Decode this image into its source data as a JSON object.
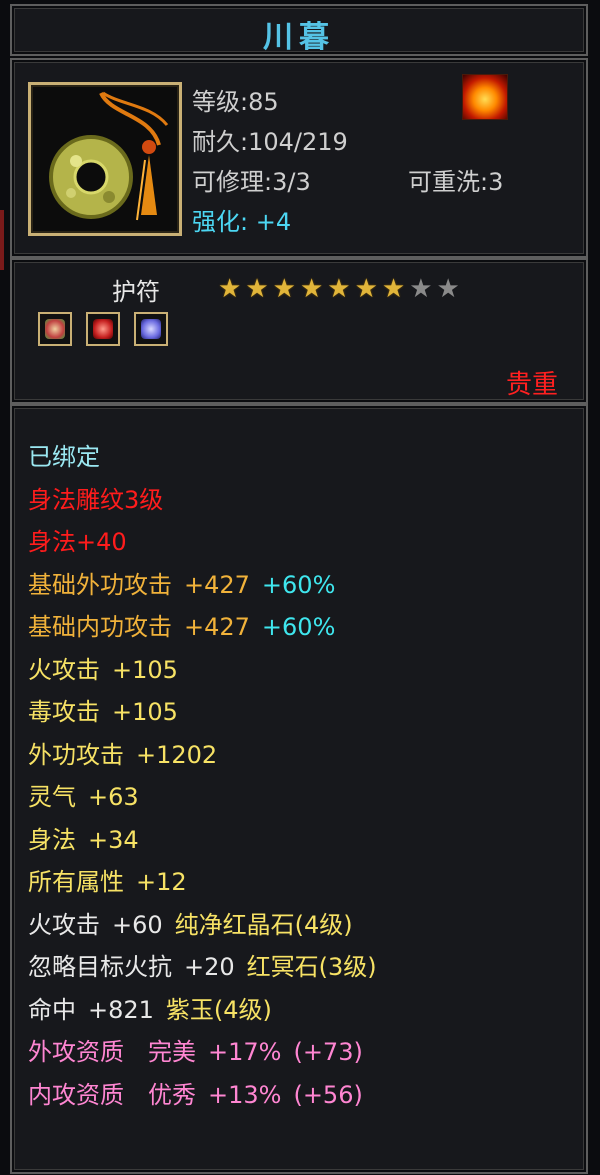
{
  "title": "川暮",
  "item": {
    "icon": "jade-ring-amulet-icon",
    "level": "等级:85",
    "durability": "耐久:104/219",
    "repair": "可修理:3/3",
    "rewash": "可重洗:3",
    "enhance": "强化: +4",
    "element_icon": "fire-element-icon"
  },
  "meta": {
    "type": "护符",
    "stars_filled": 7,
    "stars_total": 9,
    "gems": [
      {
        "icon": "green-red-gem-icon",
        "color": "#c9a080"
      },
      {
        "icon": "red-gem-icon",
        "color": "#c62020"
      },
      {
        "icon": "purple-gem-icon",
        "color": "#6a6ae0"
      }
    ],
    "rarity": "贵重"
  },
  "attributes": [
    {
      "name": "已绑定",
      "color": "cyan"
    },
    {
      "name": "身法雕纹3级",
      "color": "red"
    },
    {
      "name": "身法+40",
      "color": "red"
    },
    {
      "name": "基础外功攻击",
      "value": "+427",
      "extra": "+60%",
      "color": "orange"
    },
    {
      "name": "基础内功攻击",
      "value": "+427",
      "extra": "+60%",
      "color": "orange"
    },
    {
      "name": "火攻击",
      "value": "+105",
      "color": "yellow"
    },
    {
      "name": "毒攻击",
      "value": "+105",
      "color": "yellow"
    },
    {
      "name": "外功攻击",
      "value": "+1202",
      "color": "yellow"
    },
    {
      "name": "灵气",
      "value": "+63",
      "color": "yellow"
    },
    {
      "name": "身法",
      "value": "+34",
      "color": "yellow"
    },
    {
      "name": "所有属性",
      "value": "+12",
      "color": "yellow"
    },
    {
      "name": "火攻击",
      "value": "+60",
      "gem": "纯净红晶石(4级)",
      "color": "white"
    },
    {
      "name": "忽略目标火抗",
      "value": "+20",
      "gem": "红冥石(3级)",
      "color": "white"
    },
    {
      "name": "命中",
      "value": "+821",
      "gem": "紫玉(4级)",
      "color": "white"
    },
    {
      "name": "外攻资质",
      "quality": "完美",
      "value": "+17%",
      "bonus": "(+73)",
      "color": "pink"
    },
    {
      "name": "内攻资质",
      "quality": "优秀",
      "value": "+13%",
      "bonus": "(+56)",
      "color": "pink"
    }
  ],
  "colors": {
    "title": "#55c3e6",
    "rarity": "#ff2020",
    "bound": "#9be8f2"
  }
}
